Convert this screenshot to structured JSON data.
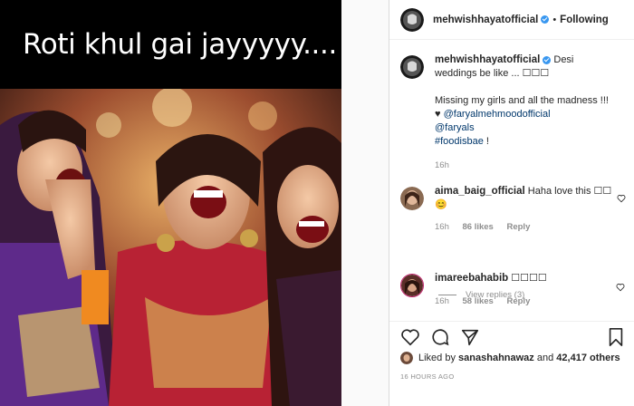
{
  "meme": {
    "caption_text": "Roti khul gai jayyyyy...."
  },
  "header": {
    "username": "mehwishhayatofficial",
    "separator": "•",
    "follow_label": "Following"
  },
  "caption": {
    "username": "mehwishhayatofficial",
    "text_1": "Desi weddings be like ... ☐☐☐",
    "text_2": "Missing my girls and all the madness !!! ♥",
    "mention_1": "@faryalmehmoodofficial",
    "mention_2": "@faryals",
    "hashtag": "#foodisbae",
    "tail": " !",
    "time": "16h"
  },
  "comments": [
    {
      "username": "aima_baig_official",
      "text": "Haha love this ☐☐😊",
      "time": "16h",
      "likes": "86 likes",
      "reply": "Reply"
    },
    {
      "username": "imareebahabib",
      "text": "☐☐☐☐",
      "time": "16h",
      "likes": "58 likes",
      "reply": "Reply"
    }
  ],
  "view_replies": "View replies (3)",
  "likes": {
    "prefix": "Liked by",
    "user": "sanashahnawaz",
    "and": "and",
    "count": "42,417 others"
  },
  "time_ago": "16 HOURS AGO",
  "icons": [
    "heart-icon",
    "comment-icon",
    "share-icon",
    "bookmark-icon"
  ],
  "colors": {
    "link": "#00376b",
    "verified": "#3897f0",
    "muted": "#8e8e8e"
  }
}
